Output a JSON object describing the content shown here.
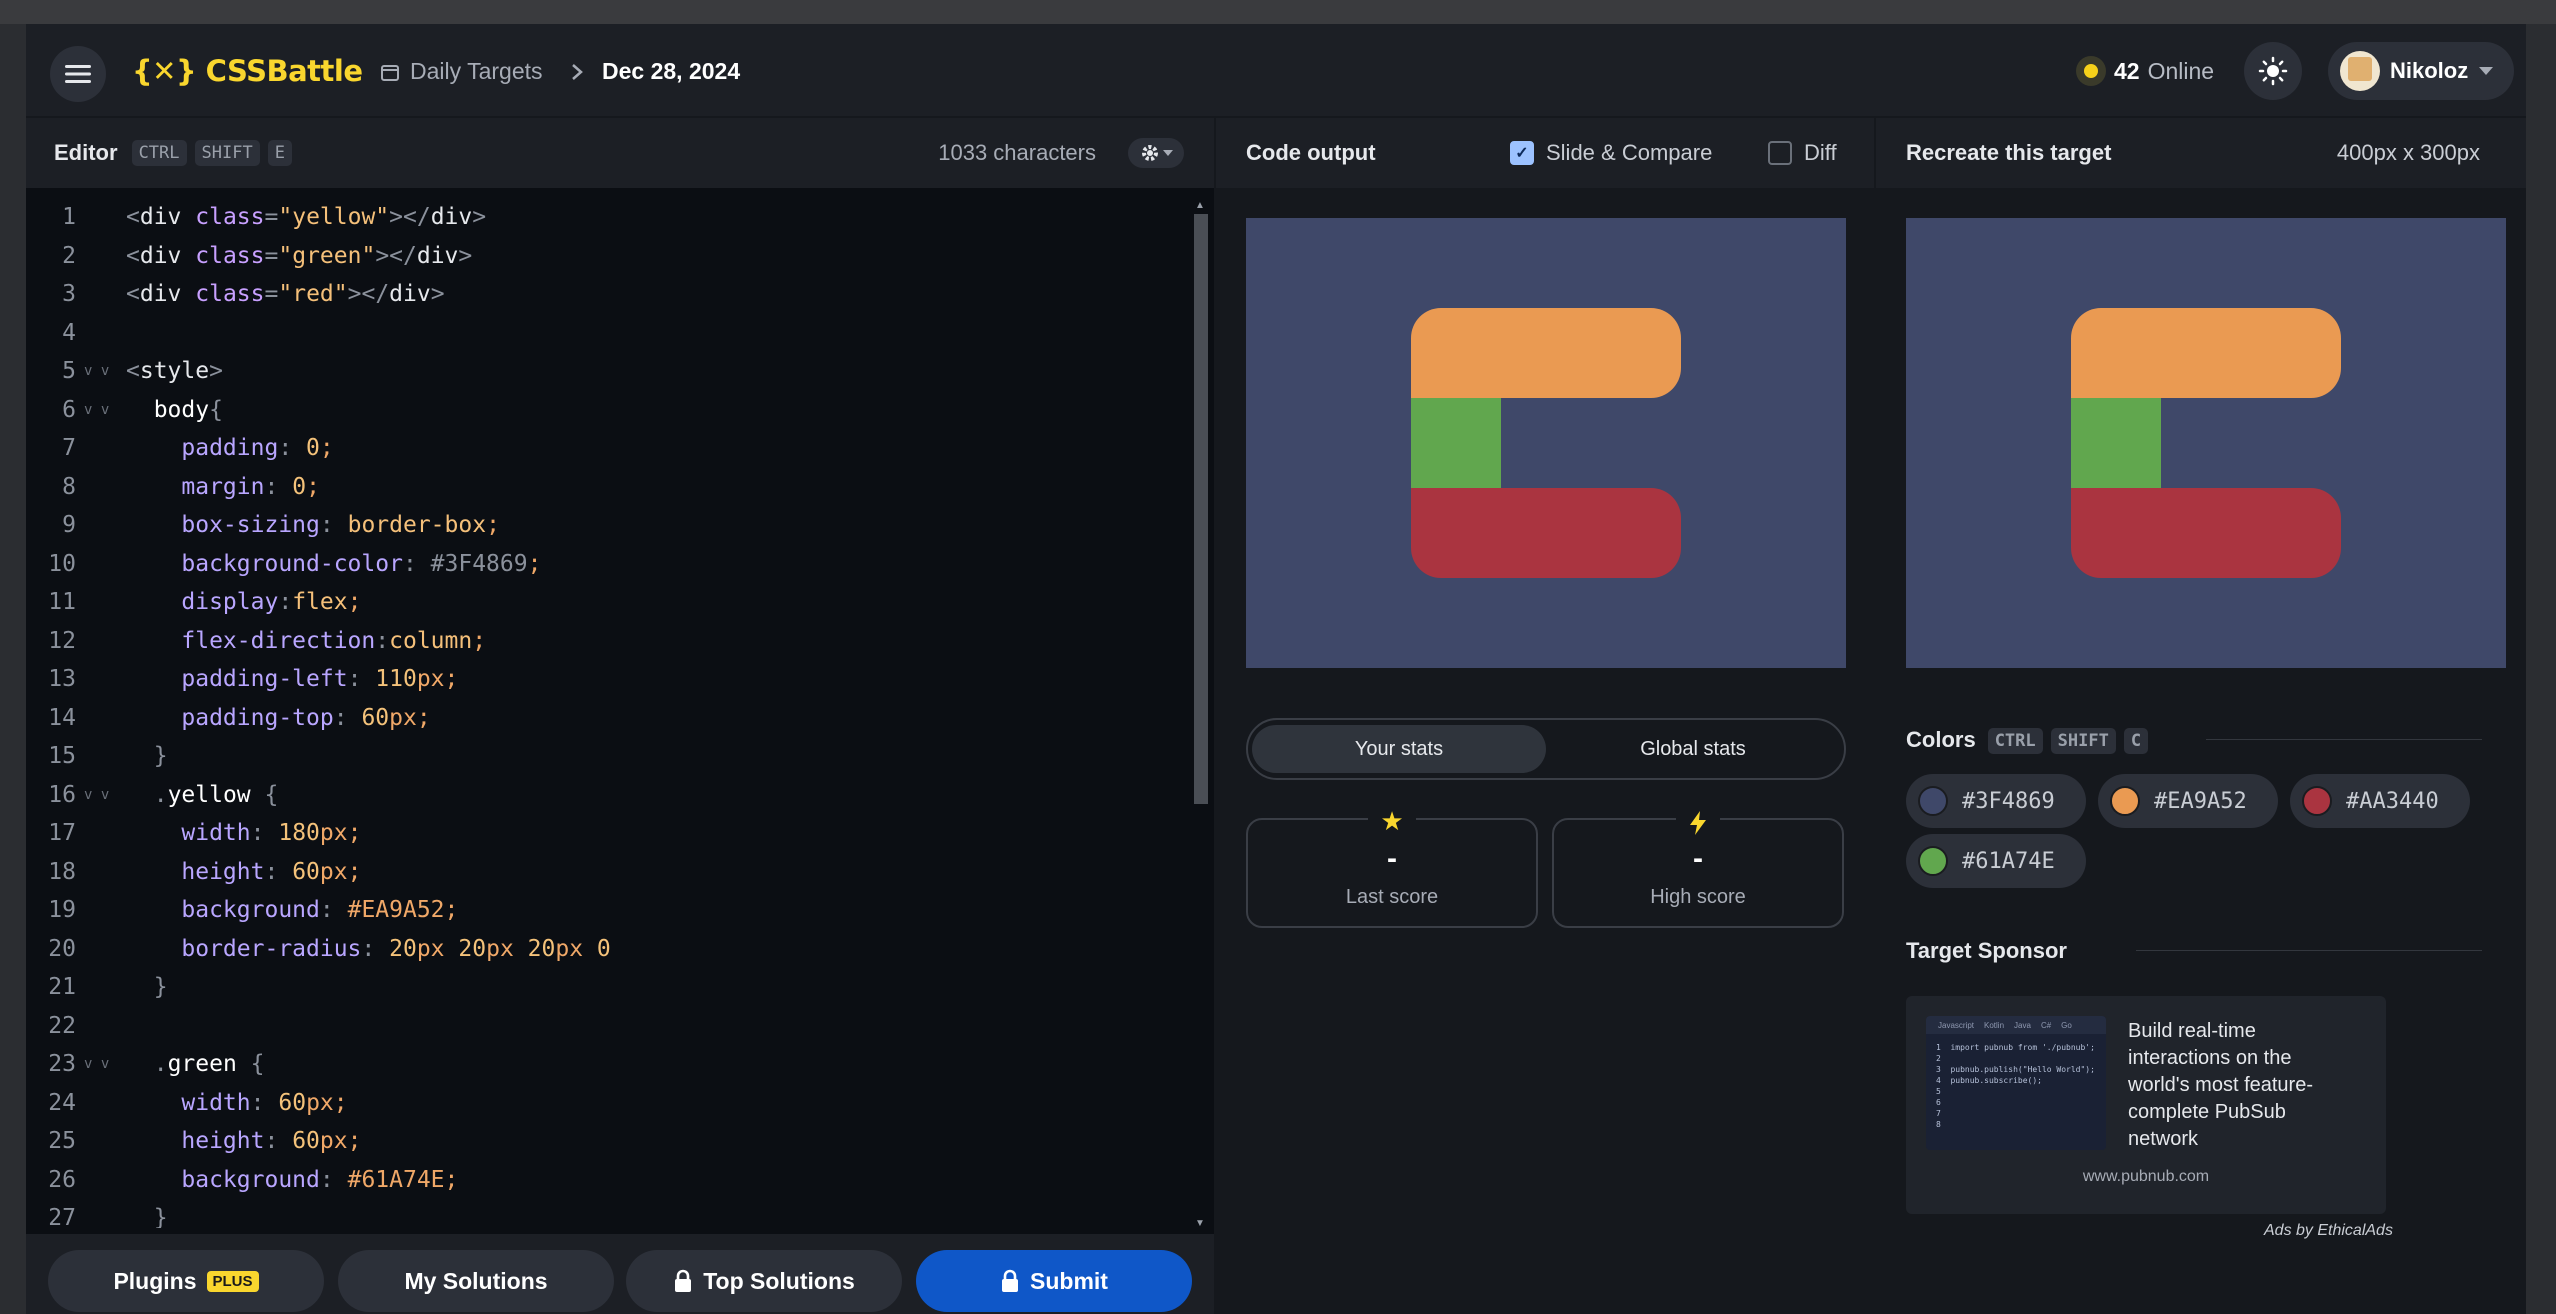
{
  "header": {
    "logo": "{✕} CSSBattle",
    "breadcrumb_section": "Daily Targets",
    "breadcrumb_date": "Dec 28, 2024",
    "online_count": "42",
    "online_label": "Online",
    "user_name": "Nikoloz"
  },
  "editor": {
    "title": "Editor",
    "shortcut": [
      "CTRL",
      "SHIFT",
      "E"
    ],
    "char_count": "1033 characters",
    "lines": [
      {
        "n": "1",
        "fold": "",
        "html": "<span class='c-punc'>&lt;</span><span class='c-tag'>div</span> <span class='c-attr'>class</span><span class='c-punc'>=</span><span class='c-str'>\"yellow\"</span><span class='c-punc'>&gt;&lt;/</span><span class='c-tag'>div</span><span class='c-punc'>&gt;</span>"
      },
      {
        "n": "2",
        "fold": "",
        "html": "<span class='c-punc'>&lt;</span><span class='c-tag'>div</span> <span class='c-attr'>class</span><span class='c-punc'>=</span><span class='c-str'>\"green\"</span><span class='c-punc'>&gt;&lt;/</span><span class='c-tag'>div</span><span class='c-punc'>&gt;</span>"
      },
      {
        "n": "3",
        "fold": "",
        "html": "<span class='c-punc'>&lt;</span><span class='c-tag'>div</span> <span class='c-attr'>class</span><span class='c-punc'>=</span><span class='c-str'>\"red\"</span><span class='c-punc'>&gt;&lt;/</span><span class='c-tag'>div</span><span class='c-punc'>&gt;</span>"
      },
      {
        "n": "4",
        "fold": "",
        "html": ""
      },
      {
        "n": "5",
        "fold": "v v",
        "html": "<span class='c-punc'>&lt;</span><span class='c-tag'>style</span><span class='c-punc'>&gt;</span>"
      },
      {
        "n": "6",
        "fold": "v v",
        "html": "  <span class='c-sel'>body</span><span class='c-punc'>{</span>"
      },
      {
        "n": "7",
        "fold": "",
        "html": "    <span class='c-prop'>padding</span><span class='c-punc'>:</span> <span class='c-num'>0</span><span class='c-unit'>;</span>"
      },
      {
        "n": "8",
        "fold": "",
        "html": "    <span class='c-prop'>margin</span><span class='c-punc'>:</span> <span class='c-num'>0</span><span class='c-unit'>;</span>"
      },
      {
        "n": "9",
        "fold": "",
        "html": "    <span class='c-prop'>box-sizing</span><span class='c-punc'>:</span> <span class='c-str'>border-box</span><span class='c-unit'>;</span>"
      },
      {
        "n": "10",
        "fold": "",
        "html": "    <span class='c-prop'>background-color</span><span class='c-punc'>:</span> <span class='c-punc'>#3F4869</span><span class='c-unit'>;</span>"
      },
      {
        "n": "11",
        "fold": "",
        "html": "    <span class='c-prop'>display</span><span class='c-punc'>:</span><span class='c-str'>flex</span><span class='c-unit'>;</span>"
      },
      {
        "n": "12",
        "fold": "",
        "html": "    <span class='c-prop'>flex-direction</span><span class='c-punc'>:</span><span class='c-str'>column</span><span class='c-unit'>;</span>"
      },
      {
        "n": "13",
        "fold": "",
        "html": "    <span class='c-prop'>padding-left</span><span class='c-punc'>:</span> <span class='c-num'>110</span><span class='c-unit'>px;</span>"
      },
      {
        "n": "14",
        "fold": "",
        "html": "    <span class='c-prop'>padding-top</span><span class='c-punc'>:</span> <span class='c-num'>60</span><span class='c-unit'>px;</span>"
      },
      {
        "n": "15",
        "fold": "",
        "html": "  <span class='c-punc'>}</span>"
      },
      {
        "n": "16",
        "fold": "v v",
        "html": "  <span class='c-punc'>.</span><span class='c-sel'>yellow</span> <span class='c-punc'>{</span>"
      },
      {
        "n": "17",
        "fold": "",
        "html": "    <span class='c-prop'>width</span><span class='c-punc'>:</span> <span class='c-num'>180</span><span class='c-unit'>px;</span>"
      },
      {
        "n": "18",
        "fold": "",
        "html": "    <span class='c-prop'>height</span><span class='c-punc'>:</span> <span class='c-num'>60</span><span class='c-unit'>px;</span>"
      },
      {
        "n": "19",
        "fold": "",
        "html": "    <span class='c-prop'>background</span><span class='c-punc'>:</span> <span class='c-hex'>#EA9A52</span><span class='c-unit'>;</span>"
      },
      {
        "n": "20",
        "fold": "",
        "html": "    <span class='c-prop'>border-radius</span><span class='c-punc'>:</span> <span class='c-num'>20</span><span class='c-unit'>px</span> <span class='c-num'>20</span><span class='c-unit'>px</span> <span class='c-num'>20</span><span class='c-unit'>px</span> <span class='c-num'>0</span>"
      },
      {
        "n": "21",
        "fold": "",
        "html": "  <span class='c-punc'>}</span>"
      },
      {
        "n": "22",
        "fold": "",
        "html": ""
      },
      {
        "n": "23",
        "fold": "v v",
        "html": "  <span class='c-punc'>.</span><span class='c-sel'>green</span> <span class='c-punc'>{</span>"
      },
      {
        "n": "24",
        "fold": "",
        "html": "    <span class='c-prop'>width</span><span class='c-punc'>:</span> <span class='c-num'>60</span><span class='c-unit'>px;</span>"
      },
      {
        "n": "25",
        "fold": "",
        "html": "    <span class='c-prop'>height</span><span class='c-punc'>:</span> <span class='c-num'>60</span><span class='c-unit'>px;</span>"
      },
      {
        "n": "26",
        "fold": "",
        "html": "    <span class='c-prop'>background</span><span class='c-punc'>:</span> <span class='c-hex'>#61A74E</span><span class='c-unit'>;</span>"
      },
      {
        "n": "27",
        "fold": "",
        "html": "  <span class='c-punc'>}</span>"
      }
    ]
  },
  "footer": {
    "plugins_label": "Plugins",
    "plus_badge": "PLUS",
    "my_solutions_label": "My Solutions",
    "top_solutions_label": "Top Solutions",
    "submit_label": "Submit"
  },
  "output": {
    "title": "Code output",
    "slide_compare_label": "Slide & Compare",
    "slide_compare_checked": true,
    "diff_label": "Diff",
    "diff_checked": false,
    "tab_your_stats": "Your stats",
    "tab_global_stats": "Global stats",
    "last_score_value": "-",
    "last_score_label": "Last score",
    "high_score_value": "-",
    "high_score_label": "High score"
  },
  "target": {
    "title": "Recreate this target",
    "dimensions": "400px x 300px",
    "colors_title": "Colors",
    "colors_shortcut": [
      "CTRL",
      "SHIFT",
      "C"
    ],
    "colors": [
      "#3F4869",
      "#EA9A52",
      "#AA3440",
      "#61A74E"
    ],
    "sponsor_title": "Target Sponsor",
    "ad_text": "Build real-time interactions on the world's most feature-complete PubSub network",
    "ad_url": "www.pubnub.com",
    "ad_tabs": [
      "Javascript",
      "Kotlin",
      "Java",
      "C#",
      "Go"
    ],
    "ad_code": [
      "1  import pubnub from './pubnub';",
      "2",
      "3  pubnub.publish(\"Hello World\");",
      "4  pubnub.subscribe();",
      "5",
      "6",
      "7",
      "8"
    ],
    "ads_by": "Ads by EthicalAds"
  },
  "colors": {
    "background": "#3F4869",
    "yellow": "#EA9A52",
    "green": "#61A74E",
    "red": "#AA3440",
    "accent_yellow": "#F9D62E",
    "submit_blue": "#0F57C8"
  },
  "icons": {
    "menu": "hamburger-icon",
    "calendar": "calendar-icon",
    "chevron": "chevron-right-icon",
    "theme": "sun-icon",
    "gear": "gear-icon",
    "lock": "lock-icon",
    "star": "star-icon",
    "bolt": "bolt-icon"
  }
}
